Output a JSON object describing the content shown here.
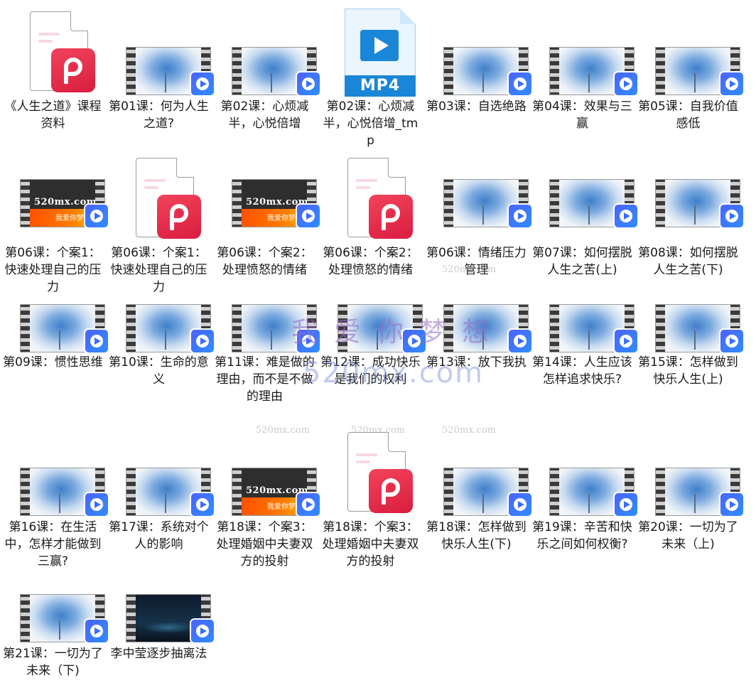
{
  "files": [
    {
      "label": "《人生之道》课程资料",
      "type": "pdf"
    },
    {
      "label": "第01课：何为人生之道?",
      "type": "video",
      "art": "blue"
    },
    {
      "label": "第02课：心烦减半，心悦倍增",
      "type": "video",
      "art": "blue"
    },
    {
      "label": "第02课：心烦减半，心悦倍增_tmp",
      "type": "mp4"
    },
    {
      "label": "第03课：自选绝路",
      "type": "video",
      "art": "blue"
    },
    {
      "label": "第04课：效果与三赢",
      "type": "video",
      "art": "blue"
    },
    {
      "label": "第05课：自我价值感低",
      "type": "video",
      "art": "blue"
    },
    {
      "label": "第06课：个案1：快速处理自己的压力",
      "type": "video",
      "art": "web"
    },
    {
      "label": "第06课：个案1：快速处理自己的压力",
      "type": "pdf"
    },
    {
      "label": "第06课：个案2：处理愤怒的情绪",
      "type": "video",
      "art": "web"
    },
    {
      "label": "第06课：个案2：处理愤怒的情绪",
      "type": "pdf"
    },
    {
      "label": "第06课：情绪压力管理",
      "type": "video",
      "art": "blue"
    },
    {
      "label": "第07课：如何摆脱人生之苦(上)",
      "type": "video",
      "art": "blue"
    },
    {
      "label": "第08课：如何摆脱人生之苦(下)",
      "type": "video",
      "art": "blue"
    },
    {
      "label": "第09课：惯性思维",
      "type": "video",
      "art": "blue"
    },
    {
      "label": "第10课：生命的意义",
      "type": "video",
      "art": "blue"
    },
    {
      "label": "第11课：难是做的理由，而不是不做的理由",
      "type": "video",
      "art": "blue"
    },
    {
      "label": "第12课：成功快乐是我们的权利",
      "type": "video",
      "art": "blue"
    },
    {
      "label": "第13课：放下我执",
      "type": "video",
      "art": "blue"
    },
    {
      "label": "第14课：人生应该怎样追求快乐?",
      "type": "video",
      "art": "blue"
    },
    {
      "label": "第15课：怎样做到快乐人生(上)",
      "type": "video",
      "art": "blue"
    },
    {
      "label": "第16课：在生活中，怎样才能做到三赢?",
      "type": "video",
      "art": "blue"
    },
    {
      "label": "第17课：系统对个人的影响",
      "type": "video",
      "art": "blue"
    },
    {
      "label": "第18课：个案3：处理婚姻中夫妻双方的投射",
      "type": "video",
      "art": "web"
    },
    {
      "label": "第18课：个案3：处理婚姻中夫妻双方的投射",
      "type": "pdf"
    },
    {
      "label": "第18课：怎样做到快乐人生(下)",
      "type": "video",
      "art": "blue"
    },
    {
      "label": "第19课：辛苦和快乐之间如何权衡?",
      "type": "video",
      "art": "blue"
    },
    {
      "label": "第20课：一切为了未来（上)",
      "type": "video",
      "art": "blue"
    },
    {
      "label": "第21课：一切为了未来（下)",
      "type": "video",
      "art": "blue"
    },
    {
      "label": "李中莹逐步抽离法",
      "type": "video",
      "art": "night"
    }
  ],
  "thumb_text": {
    "web_site": "520mx.com",
    "web_slogan": "我爱你梦想",
    "mp4_badge": "MP4"
  },
  "watermarks": {
    "cn": "我爱你梦想",
    "big": "520mx.com",
    "small": [
      "520mx.com",
      "520mx.com",
      "520mx.com",
      "520mx.com"
    ]
  },
  "colors": {
    "pdf_badge": "#e52b4a",
    "play_badge": "#3f6bff",
    "mp4_blue": "#1a86d7"
  },
  "icons": {
    "pdf": "pdf-file-icon",
    "video": "video-thumbnail-icon",
    "mp4": "mp4-file-icon",
    "play": "play-badge-icon"
  }
}
